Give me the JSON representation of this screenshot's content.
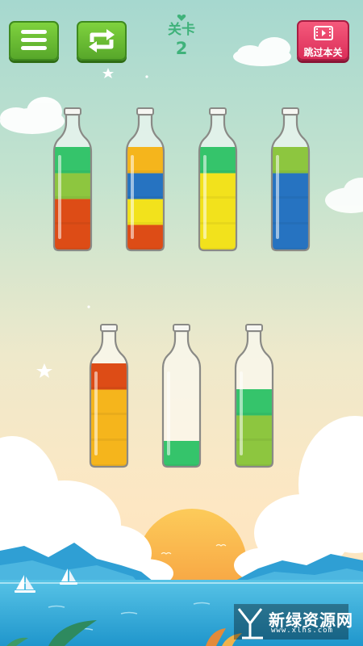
{
  "header": {
    "level_title": "关卡",
    "level_number": "2",
    "skip_label": "跳过本关"
  },
  "icons": {
    "menu": "menu-icon",
    "restart": "restart-icon",
    "video": "video-icon"
  },
  "colors": {
    "button_green": "#62b52e",
    "button_red": "#e23b63",
    "level_text": "#3fb27a",
    "liquid_green": "#35c46b",
    "liquid_lime": "#8dc63f",
    "liquid_orange": "#dd4c16",
    "liquid_yellow": "#f2e21c",
    "liquid_amber": "#f5b51c",
    "liquid_blue": "#2673c1"
  },
  "bottles": [
    {
      "layers": [
        "#dd4c16",
        "#dd4c16",
        "#8dc63f",
        "#35c46b"
      ]
    },
    {
      "layers": [
        "#dd4c16",
        "#f2e21c",
        "#2673c1",
        "#f5b51c"
      ]
    },
    {
      "layers": [
        "#f2e21c",
        "#f2e21c",
        "#f2e21c",
        "#35c46b"
      ]
    },
    {
      "layers": [
        "#2673c1",
        "#2673c1",
        "#2673c1",
        "#8dc63f"
      ]
    },
    {
      "layers": [
        "#f5b51c",
        "#f5b51c",
        "#f5b51c",
        "#dd4c16"
      ]
    },
    {
      "layers": [
        "#35c46b"
      ]
    },
    {
      "layers": [
        "#8dc63f",
        "#8dc63f",
        "#35c46b"
      ]
    }
  ],
  "watermark": {
    "text": "新绿资源网",
    "url": "www.xlhs.com",
    "logo": "xl-logo-icon"
  }
}
